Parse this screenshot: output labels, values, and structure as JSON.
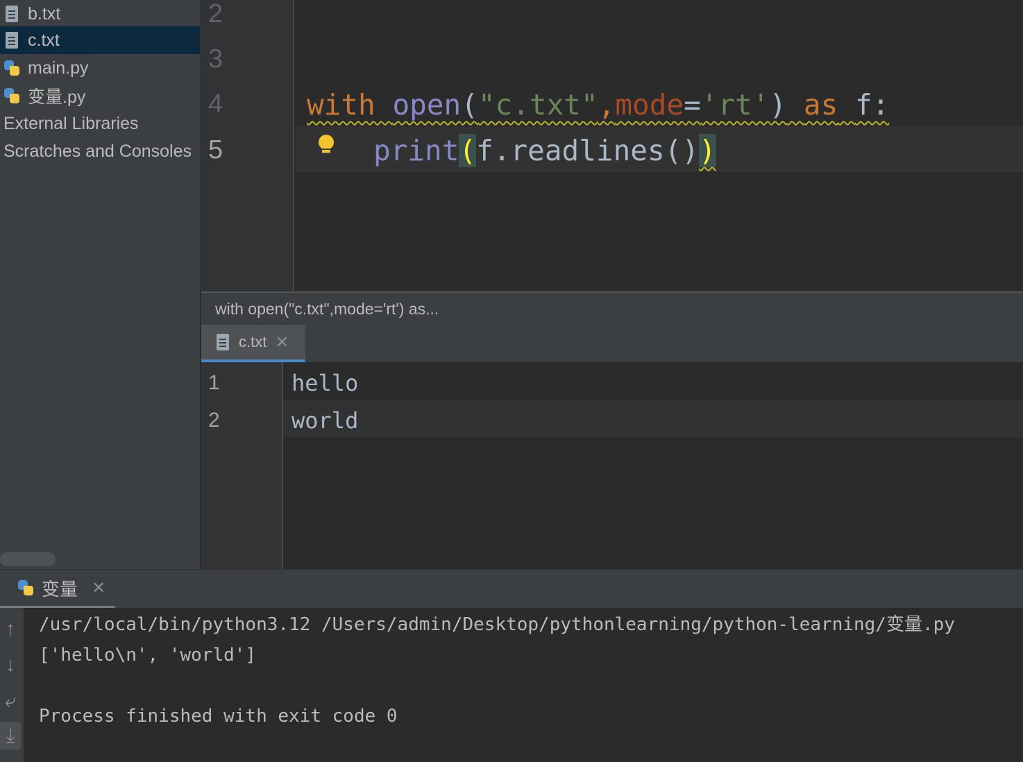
{
  "project_tree": {
    "items": [
      {
        "label": "b.txt",
        "icon": "text-file-icon",
        "selected": false
      },
      {
        "label": "c.txt",
        "icon": "text-file-icon",
        "selected": true
      },
      {
        "label": "main.py",
        "icon": "python-file-icon",
        "selected": false
      },
      {
        "label": "变量.py",
        "icon": "python-file-icon",
        "selected": false
      },
      {
        "label": "External Libraries",
        "icon": "",
        "selected": false
      },
      {
        "label": "Scratches and Consoles",
        "icon": "",
        "selected": false
      }
    ]
  },
  "editor": {
    "line_numbers": [
      "2",
      "3",
      "4",
      "5"
    ],
    "line4": {
      "with": "with",
      "open": "open",
      "lparen": "(",
      "filename": "\"c.txt\"",
      "comma": ",",
      "mode": "mode",
      "eq": "=",
      "mode_value": "'rt'",
      "rparen": ")",
      "as": "as",
      "var": "f:"
    },
    "line5": {
      "print": "print",
      "lparen": "(",
      "call": "f.readlines()",
      "rparen": ")"
    }
  },
  "breadcrumb": {
    "text": "with open(\"c.txt\",mode='rt') as..."
  },
  "second_editor": {
    "tab_label": "c.txt",
    "lines": [
      {
        "number": "1",
        "text": "hello"
      },
      {
        "number": "2",
        "text": "world"
      }
    ]
  },
  "run_panel": {
    "tab_label": "变量",
    "console_lines": [
      "/usr/local/bin/python3.12 /Users/admin/Desktop/pythonlearning/python-learning/变量.py",
      "['hello\\n', 'world']",
      "",
      "Process finished with exit code 0"
    ]
  },
  "colors": {
    "keyword": "#cc7832",
    "builtin": "#8888c6",
    "string": "#6a8759",
    "param": "#aa4926",
    "selection": "#0d293e",
    "tab_accent": "#4a88c7"
  }
}
